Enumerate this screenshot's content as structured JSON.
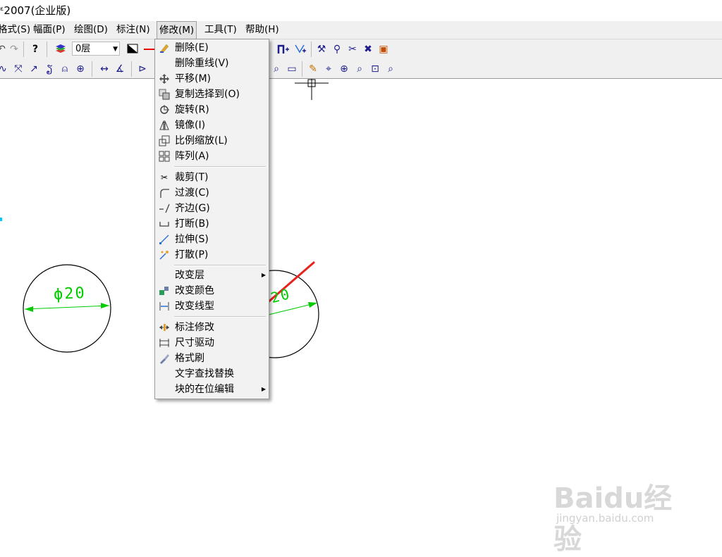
{
  "window": {
    "title": "ᵋ2007(企业版)"
  },
  "menubar": {
    "items": [
      {
        "label": "格式(S)"
      },
      {
        "label": "幅面(P)"
      },
      {
        "label": "绘图(D)"
      },
      {
        "label": "标注(N)"
      },
      {
        "label": "修改(M)"
      },
      {
        "label": "工具(T)"
      },
      {
        "label": "帮助(H)"
      }
    ]
  },
  "toolbar": {
    "layer_value": "0层"
  },
  "modify_menu": {
    "groups": [
      [
        "删除(E)",
        "删除重线(V)",
        "平移(M)",
        "复制选择到(O)",
        "旋转(R)",
        "镜像(I)",
        "比例缩放(L)",
        "阵列(A)"
      ],
      [
        "裁剪(T)",
        "过渡(C)",
        "齐边(G)",
        "打断(B)",
        "拉伸(S)",
        "打散(P)"
      ],
      [
        "改变层",
        "改变颜色",
        "改变线型"
      ],
      [
        "标注修改",
        "尺寸驱动",
        "格式刷",
        "文字查找替换",
        "块的在位编辑"
      ]
    ],
    "items": {
      "delete": "删除(E)",
      "delete_dup": "删除重线(V)",
      "move": "平移(M)",
      "copy_to": "复制选择到(O)",
      "rotate": "旋转(R)",
      "mirror": "镜像(I)",
      "scale": "比例缩放(L)",
      "array": "阵列(A)",
      "trim": "裁剪(T)",
      "fillet": "过渡(C)",
      "extend": "齐边(G)",
      "break": "打断(B)",
      "stretch": "拉伸(S)",
      "explode": "打散(P)",
      "change_layer": "改变层",
      "change_color": "改变颜色",
      "change_linetype": "改变线型",
      "dim_edit": "标注修改",
      "dim_drive": "尺寸驱动",
      "format_brush": "格式刷",
      "text_find_replace": "文字查找替换",
      "block_inplace_edit": "块的在位编辑"
    }
  },
  "drawing": {
    "left_dim": "ϕ20",
    "right_dim": "20"
  },
  "watermark": {
    "brand": "Baidu经验",
    "url": "jingyan.baidu.com"
  },
  "colors": {
    "dim_green": "#00cc00",
    "arrow_red": "#e8231f",
    "menu_bg": "#f2f2f2"
  }
}
